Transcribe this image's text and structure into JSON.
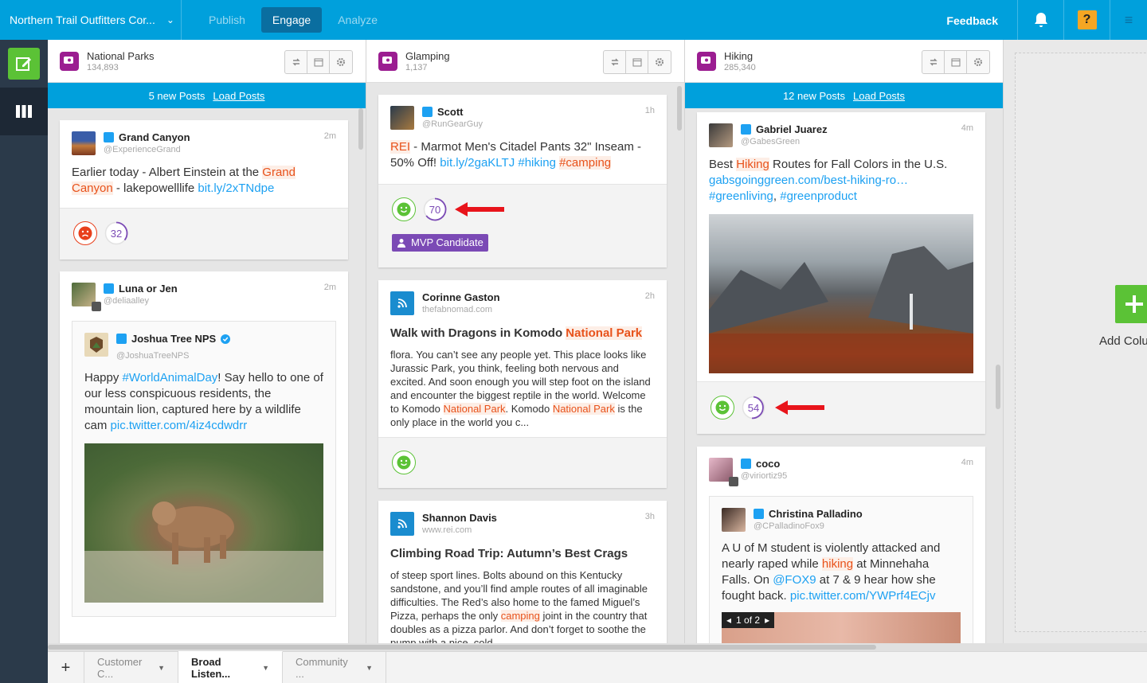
{
  "topbar": {
    "org": "Northern Trail Outfitters Cor...",
    "nav": [
      "Publish",
      "Engage",
      "Analyze"
    ],
    "active_nav": "Engage",
    "feedback": "Feedback",
    "help": "?"
  },
  "columns": [
    {
      "title": "National Parks",
      "count": "134,893",
      "new_posts": "5 new Posts",
      "load": "Load Posts",
      "cards": [
        {
          "name": "Grand Canyon",
          "handle": "@ExperienceGrand",
          "time": "2m",
          "text_parts": [
            "Earlier today - Albert Einstein at the ",
            "Grand Canyon",
            " - lakepowelllife ",
            "bit.ly/2xTNdpe"
          ],
          "score": "32"
        },
        {
          "name": "Luna or Jen",
          "handle": "@deliaalley",
          "time": "2m",
          "quote_name": "Joshua Tree NPS",
          "quote_handle": "@JoshuaTreeNPS",
          "quote_parts": [
            "Happy ",
            "#WorldAnimalDay",
            "! Say hello to one of our less conspicuous residents, the mountain lion, captured here by a wildlife cam ",
            "pic.twitter.com/4iz4cdwdrr"
          ]
        }
      ]
    },
    {
      "title": "Glamping",
      "count": "1,137",
      "cards": [
        {
          "name": "Scott",
          "handle": "@RunGearGuy",
          "time": "1h",
          "text_parts": [
            "REI",
            " - Marmot Men's Citadel Pants 32\" Inseam - 50% Off! ",
            "bit.ly/2gaKLTJ",
            " ",
            "#hiking",
            " ",
            "#camping"
          ],
          "score": "70",
          "badge": "MVP Candidate"
        },
        {
          "name": "Corinne Gaston",
          "handle": "thefabnomad.com",
          "time": "2h",
          "title_parts": [
            "Walk with Dragons in Komodo ",
            "National Park"
          ],
          "body_parts": [
            "flora. You can’t see any people yet. This place looks like Jurassic Park, you think, feeling both nervous and excited. And soon enough you will step foot on the island and encounter the biggest reptile in the world. Welcome to Komodo ",
            "National Park",
            ". Komodo ",
            "National Park",
            " is the only place in the world you c..."
          ]
        },
        {
          "name": "Shannon Davis",
          "handle": "www.rei.com",
          "time": "3h",
          "title": "Climbing Road Trip: Autumn’s Best Crags",
          "body_parts": [
            "of steep sport lines. Bolts abound on this Kentucky sandstone, and you’ll find ample routes of all imaginable difficulties. The Red’s also home to the famed Miguel’s Pizza, perhaps the only ",
            "camping",
            " joint in the country that doubles as a pizza parlor. And don’t forget to soothe the pump with a nice, cold..."
          ]
        }
      ]
    },
    {
      "title": "Hiking",
      "count": "285,340",
      "new_posts": "12 new Posts",
      "load": "Load Posts",
      "cards": [
        {
          "name": "Gabriel Juarez",
          "handle": "@GabesGreen",
          "time": "4m",
          "text_parts": [
            "Best ",
            "Hiking",
            " Routes for Fall Colors in the U.S. ",
            "gabsgoinggreen.com/best-hiking-ro…",
            " ",
            "#greenliving",
            ", ",
            "#greenproduct"
          ],
          "score": "54"
        },
        {
          "name": "coco",
          "handle": "@viriortiz95",
          "time": "4m",
          "quote_name": "Christina Palladino",
          "quote_handle": "@CPalladinoFox9",
          "quote_parts": [
            "A U of M student is violently attacked and nearly raped while ",
            "hiking",
            " at Minnehaha Falls. On ",
            "@FOX9",
            " at 7 & 9 hear how she fought back. ",
            "pic.twitter.com/YWPrf4ECjv"
          ],
          "gallery": "1 of 2"
        }
      ]
    }
  ],
  "add_column": "Add Colu",
  "tabs": [
    {
      "label": "Customer C..."
    },
    {
      "label": "Broad Listen..."
    },
    {
      "label": "Community ..."
    }
  ],
  "colors": {
    "accent": "#00a0dc",
    "green": "#5bc236",
    "purple": "#7b4ab5",
    "highlight": "#e8521b",
    "rail": "#2b3a4a"
  }
}
